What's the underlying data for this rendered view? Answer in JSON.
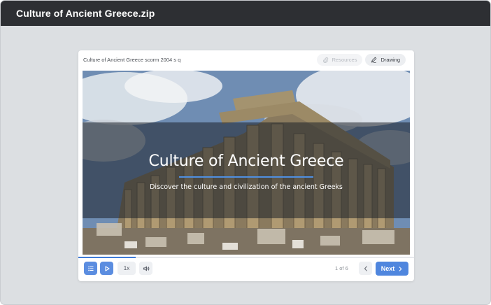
{
  "window": {
    "title": "Culture of Ancient Greece.zip"
  },
  "player": {
    "course_name": "Culture of Ancient Greece scorm 2004 s q",
    "resources_label": "Resources",
    "drawing_label": "Drawing"
  },
  "slide": {
    "title": "Culture of Ancient Greece",
    "subtitle": "Discover the culture and civilization of the ancient Greeks",
    "image": "parthenon-photo"
  },
  "progress": {
    "fraction": 0.17
  },
  "controls": {
    "speed_label": "1x",
    "page_counter": "1 of 6",
    "next_label": "Next"
  },
  "icons": {
    "menu": "list-icon",
    "play": "play-icon",
    "volume": "volume-icon",
    "prev": "chevron-left-icon",
    "next": "chevron-right-icon",
    "resources": "paperclip-icon",
    "drawing": "pen-icon"
  },
  "colors": {
    "accent": "#4f86de",
    "titlebar": "#2d2f33",
    "backdrop": "#dcdfe2"
  }
}
